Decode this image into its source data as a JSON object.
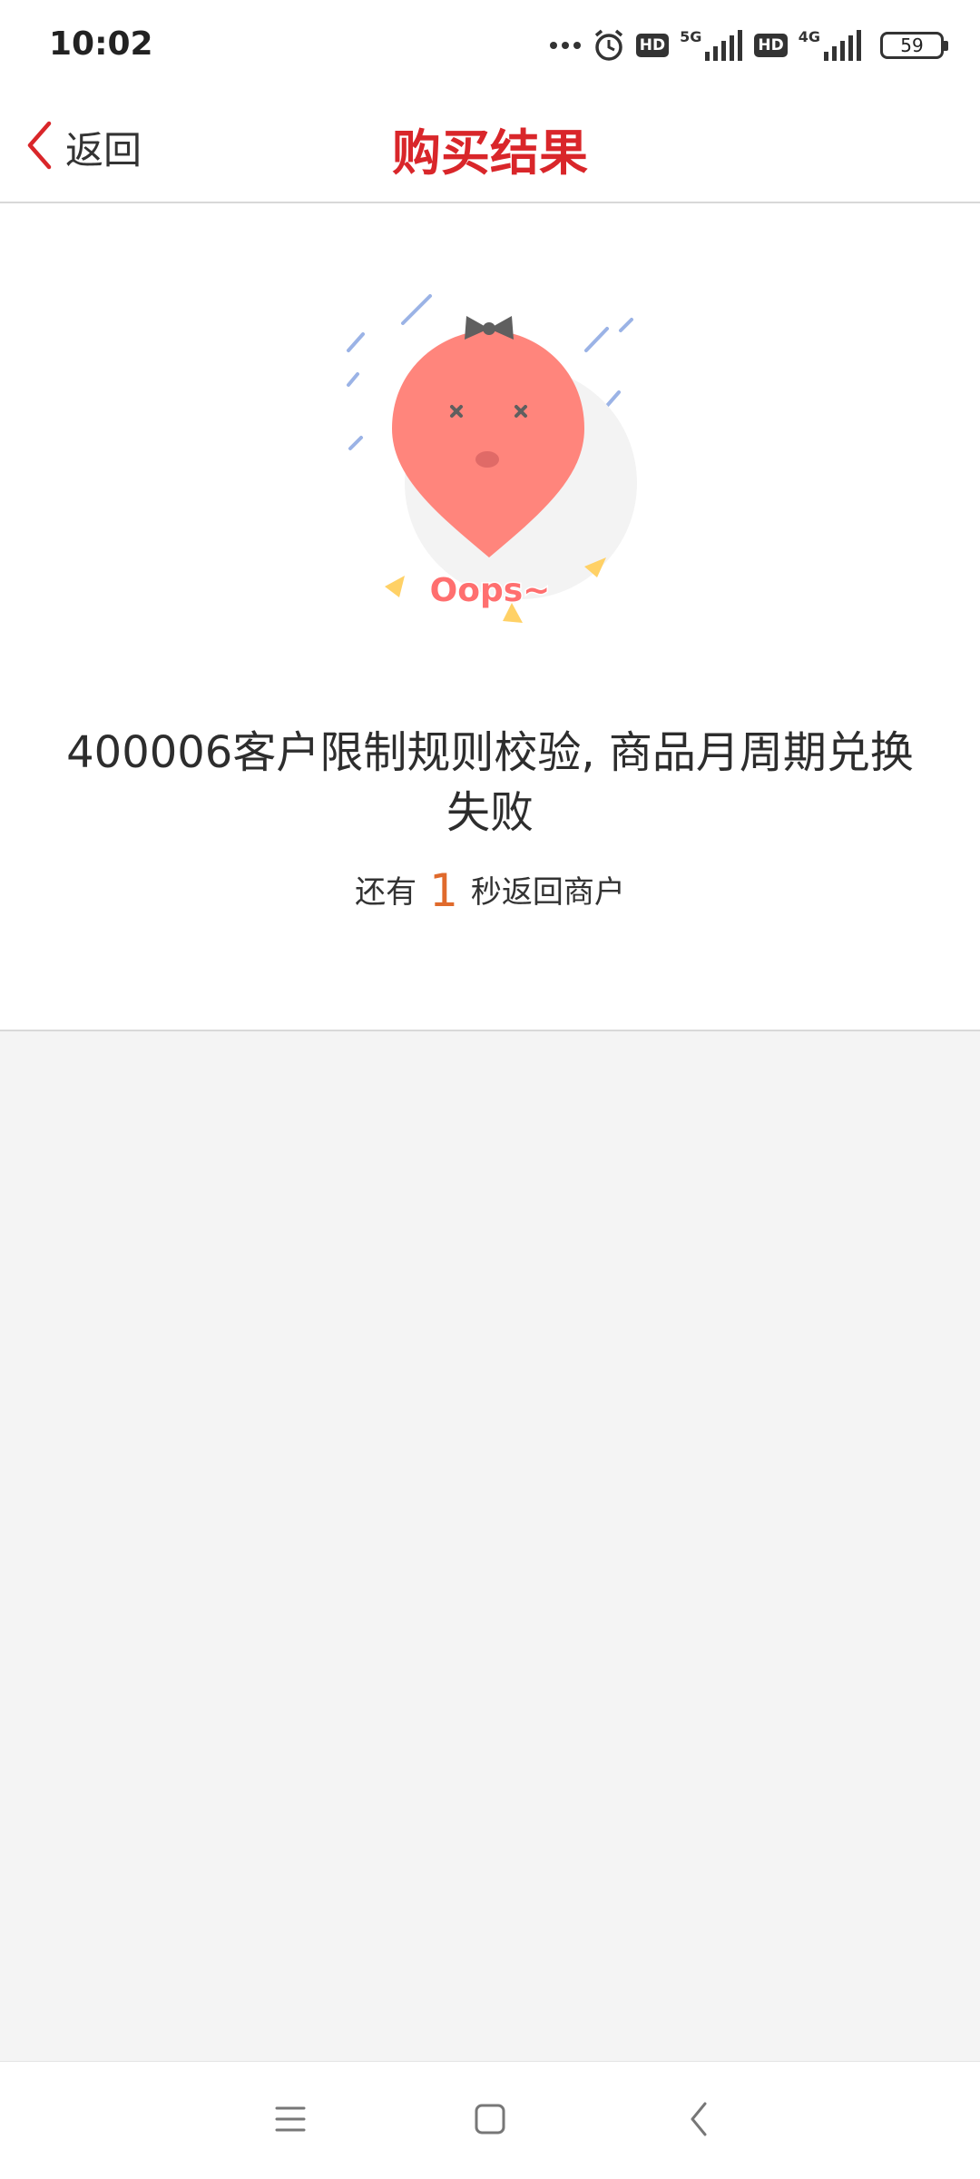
{
  "status_bar": {
    "time": "10:02",
    "battery": "59",
    "network_1": "5G",
    "network_2": "4G",
    "hd_label": "HD",
    "icons": [
      "more-dots-icon",
      "alarm-icon",
      "hd-icon",
      "signal-5g-icon",
      "hd-icon",
      "signal-4g-icon",
      "battery-icon"
    ]
  },
  "header": {
    "back_label": "返回",
    "title": "购买结果"
  },
  "result": {
    "illustration_text": "Oops~",
    "error_message": "400006客户限制规则校验, 商品月周期兑换失败",
    "countdown_prefix": "还有",
    "countdown_value": "1",
    "countdown_suffix": "秒返回商户"
  },
  "colors": {
    "accent": "#d9262a",
    "countdown": "#e06a2c",
    "background": "#f4f4f4"
  },
  "system_nav": {
    "icons": [
      "menu-icon",
      "home-icon",
      "back-icon"
    ]
  }
}
